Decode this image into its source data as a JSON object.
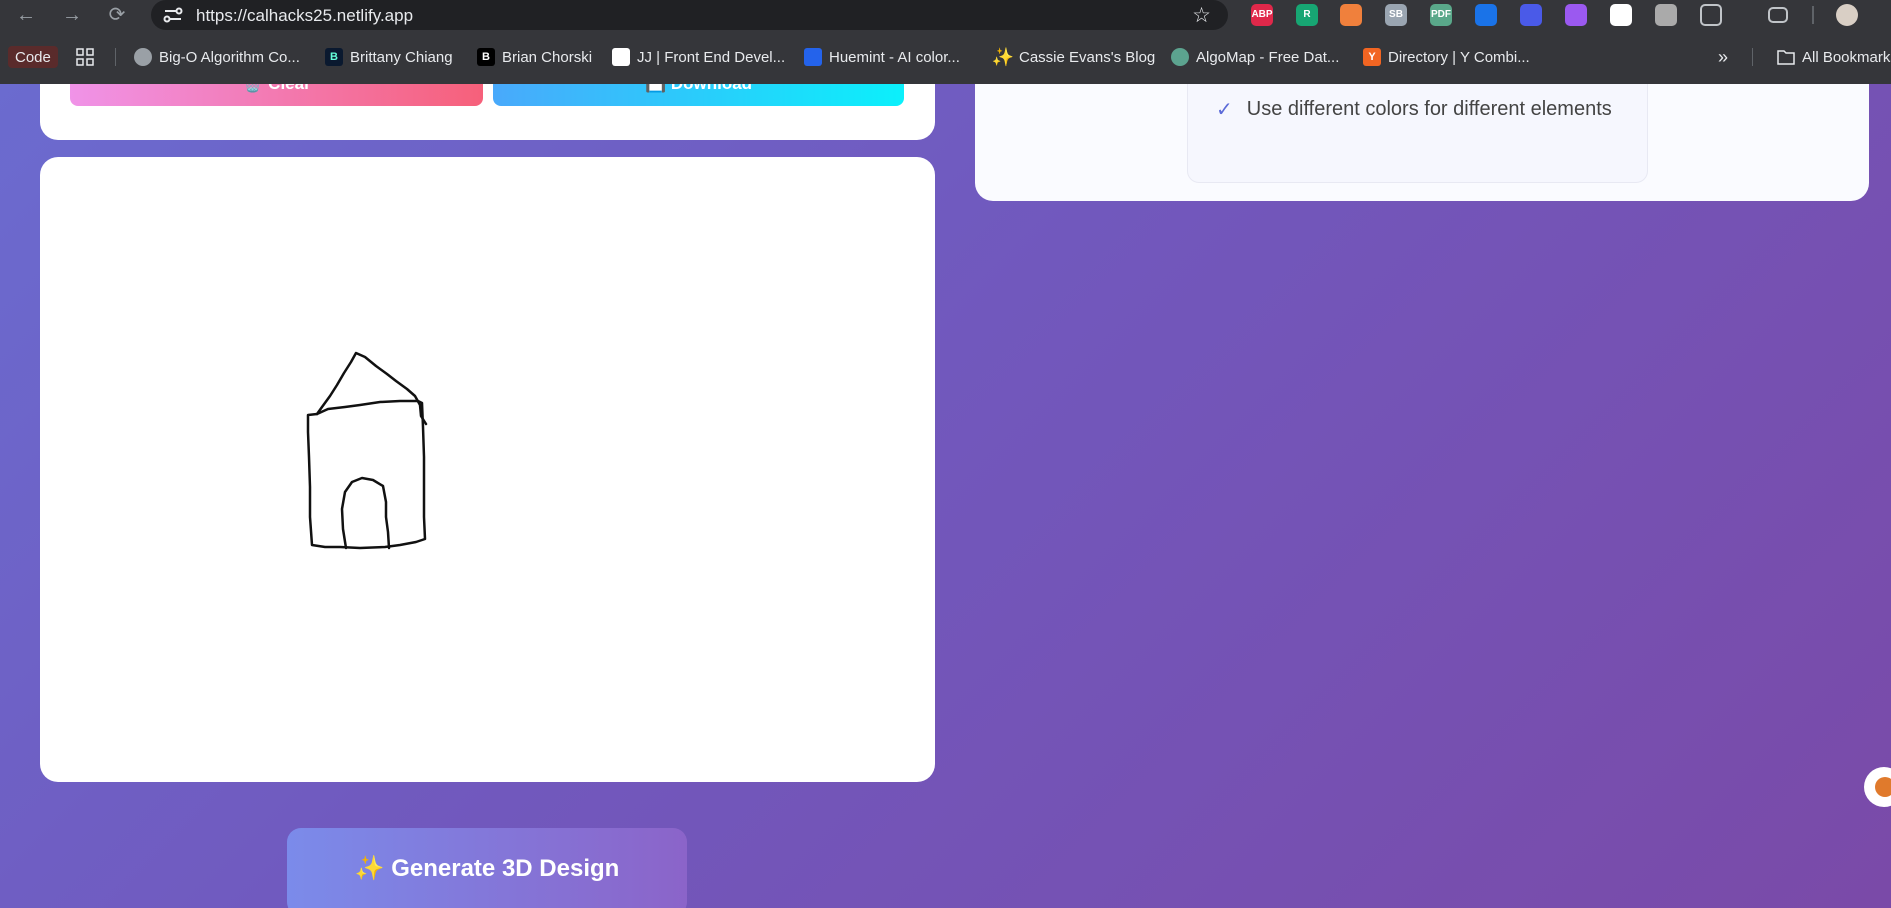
{
  "browser": {
    "url": "https://calhacks25.netlify.app",
    "extensions": [
      {
        "name": "adblock-plus-icon",
        "label": "ABP",
        "color": "#e0284a"
      },
      {
        "name": "r-extension-icon",
        "label": "R",
        "color": "#17a673"
      },
      {
        "name": "calendar-extension-icon",
        "label": "",
        "color": "#f0803c"
      },
      {
        "name": "sb-extension-icon",
        "label": "SB",
        "color": "#9aa5b1"
      },
      {
        "name": "pdf-extension-icon",
        "label": "PDF",
        "color": "#5aa88a"
      },
      {
        "name": "pin-extension-icon",
        "label": "",
        "color": "#1a73e8"
      },
      {
        "name": "bird-extension-icon",
        "label": "",
        "color": "#4a5ae8"
      },
      {
        "name": "chat-extension-icon",
        "label": "",
        "color": "#9b59f0"
      },
      {
        "name": "pen-extension-icon",
        "label": "",
        "color": "#ffffff"
      },
      {
        "name": "slash-extension-icon",
        "label": "",
        "color": "#aaaaaa"
      }
    ]
  },
  "bookmarks": [
    {
      "label": "Code",
      "icon": "code-badge",
      "color": "#3c1f1f"
    },
    {
      "label": "",
      "icon": "apps-grid-icon",
      "color": ""
    },
    {
      "label": "Big-O Algorithm Co...",
      "icon": "globe-icon",
      "color": "#9aa0a6"
    },
    {
      "label": "Brittany Chiang",
      "icon": "b-favicon",
      "color": "#0a192f"
    },
    {
      "label": "Brian Chorski",
      "icon": "b-favicon",
      "color": "#000000"
    },
    {
      "label": "JJ | Front End Devel...",
      "icon": "white-square-favicon",
      "color": "#ffffff"
    },
    {
      "label": "Huemint - AI color...",
      "icon": "huemint-favicon",
      "color": "#2463eb"
    },
    {
      "label": "Cassie Evans's Blog",
      "icon": "sparkle-favicon",
      "color": "#f7c948"
    },
    {
      "label": "AlgoMap - Free Dat...",
      "icon": "algomap-favicon",
      "color": "#5ca38f"
    },
    {
      "label": "Directory | Y Combi...",
      "icon": "yc-favicon",
      "color": "#f26522"
    },
    {
      "label": "All Bookmarks",
      "icon": "folder-icon",
      "color": ""
    }
  ],
  "page": {
    "clear_label": "🗑️ Clear",
    "download_label": "💾 Download",
    "tip": "Use different colors for different elements",
    "generate_label": "✨ Generate 3D Design"
  },
  "theme": {
    "gradient_start": "#6b6bcf",
    "gradient_end": "#7a4aa8",
    "clear_gradient": [
      "#f093e8",
      "#f6607a"
    ],
    "download_gradient": [
      "#49a9fb",
      "#0bf0fb"
    ]
  }
}
